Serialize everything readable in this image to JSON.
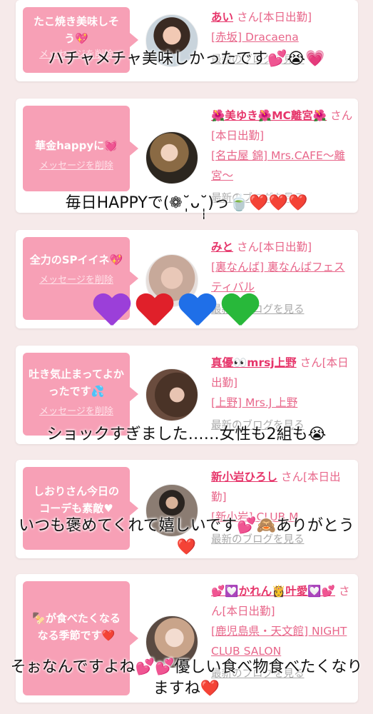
{
  "delete_label": "メッセージを削除",
  "blog_label": "最新のブログを見る",
  "entries": [
    {
      "message": "たこ焼き美味しそう💖",
      "name": "あい",
      "suffix": "さん[本日出勤]",
      "shop": "[赤坂] Dracaena",
      "comment": "ハチャメチャ美味しかったです💕😭💗"
    },
    {
      "message": "華金happyに💓",
      "name": "🌺美ゆき🌺MC離宮🌺",
      "suffix": "さん[本日出勤]",
      "shop": "[名古屋 錦] Mrs.CAFE〜離宮〜",
      "comment": "毎日HAPPYで(❁˘̩̩̩ᴗ˘̩̩̩)っ🍵❤️❤️❤️"
    },
    {
      "message": "全力のSPイイネ💖",
      "name": "みと",
      "suffix": "さん[本日出勤]",
      "shop": "[裏なんば] 裏なんばフェスティバル",
      "comment": "💜❤️💙💚"
    },
    {
      "message": "吐き気止まってよかったです💦",
      "name": "真優👀mrsj上野",
      "suffix": "さん[本日出勤]",
      "shop": "[上野] Mrs.J 上野",
      "comment": "ショックすぎました……女性も2組も😭"
    },
    {
      "message": "しおりさん今日のコーデも素敵♥",
      "name": "新小岩ひろし",
      "suffix": "さん[本日出勤]",
      "shop": "[新小岩] CLUB M",
      "comment": "いつも褒めてくれて嬉しいです💕🙈ありがとう❤️"
    },
    {
      "message": "🍢が食べたくなるなる季節です❤️",
      "name": "💕💟かれん👸叶愛💟💕",
      "suffix": "さん[本日出勤]",
      "shop": "[鹿児島県・天文館] NIGHT CLUB SALON",
      "comment": "そぉなんですよね💕💕優しい食べ物食べたくなりますね❤️"
    }
  ]
}
